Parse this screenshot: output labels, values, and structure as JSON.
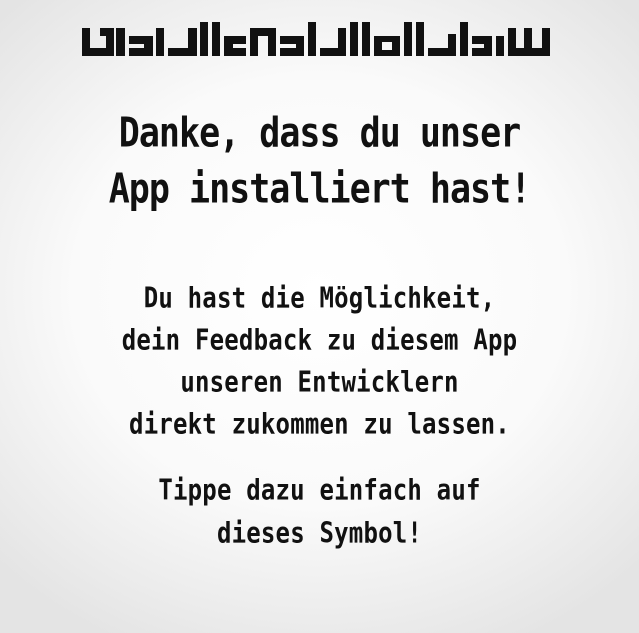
{
  "logo": {
    "name": "bismillah-kufic-calligraphy",
    "color": "#111111"
  },
  "heading": {
    "line1": "Danke, dass du unser",
    "line2": "App installiert hast!"
  },
  "body": {
    "line1": "Du hast die Möglichkeit,",
    "line2": "dein Feedback zu diesem App",
    "line3": "unseren Entwicklern",
    "line4": "direkt zukommen zu lassen.",
    "line5": "Tippe dazu einfach auf",
    "line6": "dieses Symbol!"
  },
  "colors": {
    "text": "#111111",
    "background_center": "#ffffff",
    "background_edge": "#e4e4e4"
  }
}
